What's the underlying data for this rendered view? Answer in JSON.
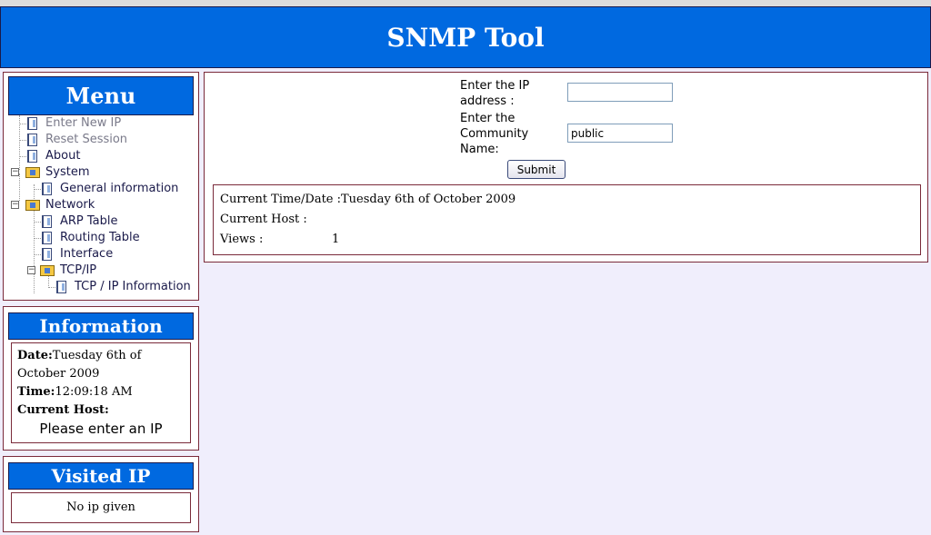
{
  "header": {
    "title": "SNMP Tool"
  },
  "menu": {
    "title": "Menu",
    "items": [
      {
        "label": "Enter New IP"
      },
      {
        "label": "Reset Session"
      },
      {
        "label": "About"
      },
      {
        "label": "System"
      },
      {
        "label": "General information"
      },
      {
        "label": "Network"
      },
      {
        "label": "ARP Table"
      },
      {
        "label": "Routing Table"
      },
      {
        "label": "Interface"
      },
      {
        "label": "TCP/IP"
      },
      {
        "label": "TCP / IP Information"
      }
    ]
  },
  "info": {
    "title": "Information",
    "date_label": "Date:",
    "date_value": "Tuesday 6th of October 2009",
    "time_label": "Time:",
    "time_value": "12:09:18 AM",
    "host_label": "Current Host:",
    "host_prompt": "Please enter an IP"
  },
  "visited": {
    "title": "Visited IP",
    "empty_text": "No ip given"
  },
  "form": {
    "ip_label_line1": "Enter the IP",
    "ip_label_line2": "address :",
    "ip_value": "",
    "community_label_line1": "Enter the",
    "community_label_line2": "Community",
    "community_label_line3": "Name:",
    "community_value": "public",
    "submit_label": "Submit"
  },
  "status": {
    "time_label": "Current Time/Date :",
    "time_value": "Tuesday 6th of October 2009",
    "host_label": "Current Host :",
    "host_value": "",
    "views_label": "Views :",
    "views_value": "1"
  },
  "colors": {
    "header_blue": "#0069e0",
    "page_background": "#f0eefc",
    "panel_border": "#7a2a3a"
  }
}
